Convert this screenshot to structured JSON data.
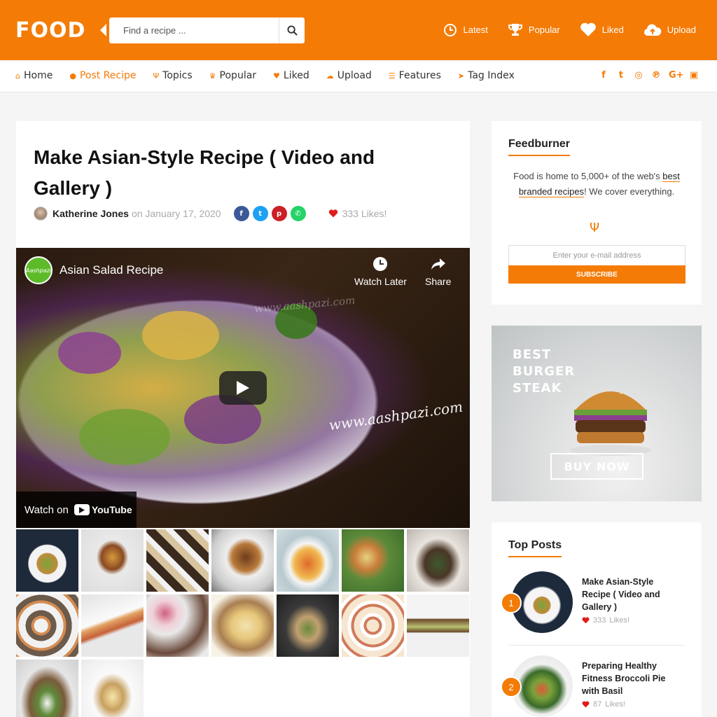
{
  "header": {
    "logo": "FOOD",
    "search_placeholder": "Find a recipe ...",
    "links": [
      {
        "label": "Latest",
        "icon": "clock-icon"
      },
      {
        "label": "Popular",
        "icon": "trophy-icon"
      },
      {
        "label": "Liked",
        "icon": "heart-icon"
      },
      {
        "label": "Upload",
        "icon": "cloud-upload-icon"
      }
    ]
  },
  "nav": {
    "items": [
      {
        "label": "Home",
        "icon": "home-icon"
      },
      {
        "label": "Post Recipe",
        "icon": "bowl-icon",
        "active": true
      },
      {
        "label": "Topics",
        "icon": "fork-knife-icon"
      },
      {
        "label": "Popular",
        "icon": "trophy-icon"
      },
      {
        "label": "Liked",
        "icon": "heart-icon"
      },
      {
        "label": "Upload",
        "icon": "cloud-upload-icon"
      },
      {
        "label": "Features",
        "icon": "sliders-icon"
      },
      {
        "label": "Tag Index",
        "icon": "tag-icon"
      }
    ],
    "socials": [
      "facebook-icon",
      "twitter-icon",
      "instagram-icon",
      "pinterest-icon",
      "google-plus-icon",
      "youtube-icon"
    ]
  },
  "post": {
    "title": "Make Asian-Style Recipe ( Video and Gallery )",
    "author": "Katherine Jones",
    "date": "on January 17, 2020",
    "likes": "333 Likes!",
    "share": [
      "facebook-icon",
      "twitter-icon",
      "pinterest-icon",
      "whatsapp-icon"
    ]
  },
  "video": {
    "channel_badge": "Aashpazi",
    "title": "Asian Salad Recipe",
    "watch_later": "Watch Later",
    "share": "Share",
    "watermark": "www.aashpazi.com",
    "watch_on": "Watch on",
    "youtube": "YouTube"
  },
  "feedburner": {
    "title": "Feedburner",
    "text_pre": "Food is home to 5,000+ of the web's ",
    "text_link": "best branded recipes",
    "text_post": "! We cover everything.",
    "email_placeholder": "Enter your e-mail address",
    "subscribe": "SUBSCRIBE"
  },
  "ad": {
    "line1": "BEST",
    "line2": "BURGER",
    "line3": "STEAK",
    "button": "BUY NOW"
  },
  "top_posts": {
    "title": "Top Posts",
    "items": [
      {
        "rank": "1",
        "title": "Make Asian-Style Recipe ( Video and Gallery )",
        "likes": "333",
        "likes_label": "Likes!"
      },
      {
        "rank": "2",
        "title": "Preparing Healthy Fitness Broccoli Pie with Basil",
        "likes": "87",
        "likes_label": "Likes!"
      }
    ]
  },
  "colors": {
    "accent": "#f47b06"
  }
}
